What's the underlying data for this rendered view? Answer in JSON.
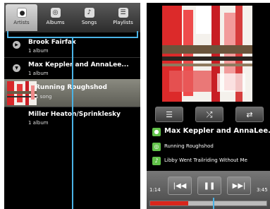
{
  "tabs": [
    {
      "label": "Artists",
      "icon": "microphone-icon",
      "active": true
    },
    {
      "label": "Albums",
      "icon": "album-icon",
      "active": false
    },
    {
      "label": "Songs",
      "icon": "music-note-icon",
      "active": false
    },
    {
      "label": "Playlists",
      "icon": "playlist-icon",
      "active": false
    }
  ],
  "artists": [
    {
      "name": "Brook Fairfax",
      "sub": "1 album",
      "expanded": false
    },
    {
      "name": "Max Keppler and AnnaLee...",
      "sub": "1 album",
      "expanded": true
    },
    {
      "name": "Running Roughshod",
      "sub": "1 song",
      "selected": true
    },
    {
      "name": "Miller Heaton/Sprinklesky",
      "sub": "1 album",
      "expanded": false
    }
  ],
  "now_playing": {
    "artist": "Max Keppler and AnnaLee...",
    "album": "Running Roughshod",
    "track": "Libby Went Trailriding Without  Me",
    "elapsed": "1:14",
    "duration": "3:45",
    "progress": 0.33
  },
  "controls": {
    "list_icon": "playlist-icon",
    "shuffle_icon": "shuffle-icon",
    "repeat_icon": "repeat-icon",
    "prev_icon": "skip-back-icon",
    "play_pause_icon": "pause-icon",
    "next_icon": "skip-forward-icon"
  },
  "colors": {
    "highlight_blue": "#4ab3e6",
    "progress_red": "#d9261c",
    "artist_icon_green": "#62c24a"
  }
}
